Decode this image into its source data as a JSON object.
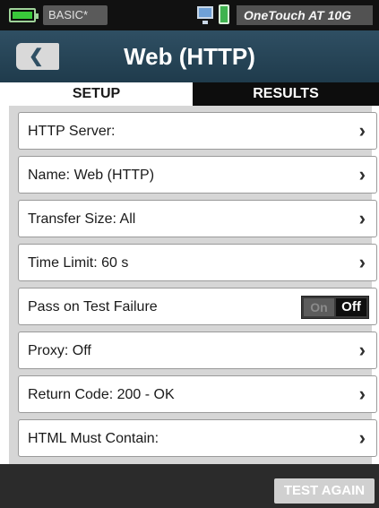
{
  "status_bar": {
    "mode_label": "BASIC*",
    "device_name": "OneTouch AT 10G"
  },
  "header": {
    "title": "Web (HTTP)"
  },
  "tabs": [
    {
      "label": "SETUP",
      "active": true
    },
    {
      "label": "RESULTS",
      "active": false
    }
  ],
  "settings": [
    {
      "label": "HTTP Server:"
    },
    {
      "label": "Name: Web (HTTP)"
    },
    {
      "label": "Transfer Size: All"
    },
    {
      "label": "Time Limit: 60 s"
    },
    {
      "label": "Pass on Test Failure",
      "toggle_on": "On",
      "toggle_off": "Off",
      "value": "Off"
    },
    {
      "label": "Proxy: Off"
    },
    {
      "label": "Return Code: 200 - OK"
    },
    {
      "label": "HTML Must Contain:"
    }
  ],
  "footer": {
    "test_again_label": "TEST AGAIN"
  },
  "colors": {
    "header": "#2f4f63",
    "battery": "#39c83a",
    "active_tab": "#ffffff",
    "inactive_tab": "#0d0d0d"
  },
  "icons": {
    "battery": "battery-icon",
    "back": "back-arrow-icon",
    "chevron": "chevron-right-icon",
    "monitor": "monitor-icon",
    "phone": "phone-icon"
  }
}
